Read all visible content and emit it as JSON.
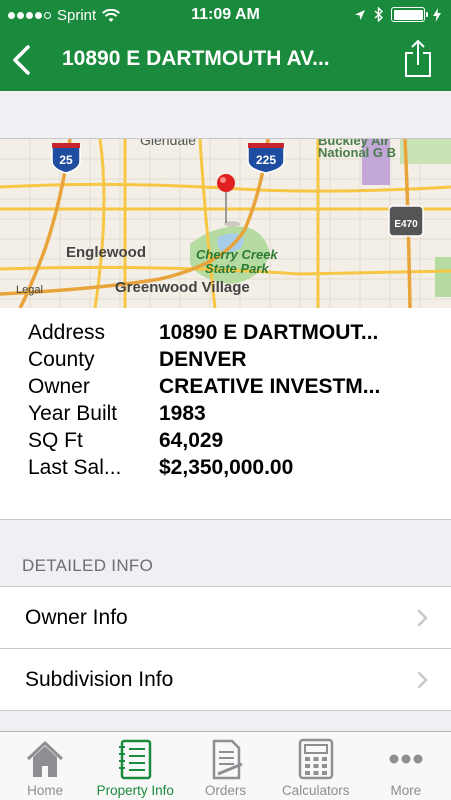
{
  "status_bar": {
    "carrier": "Sprint",
    "time": "11:09 AM",
    "signal_bars": 4,
    "battery_level": 1.0
  },
  "nav": {
    "title": "10890 E DARTMOUTH AV...",
    "back_icon": "chevron-left-icon",
    "share_icon": "share-icon"
  },
  "map": {
    "labels": {
      "glendale": "Glendale",
      "englewood": "Englewood",
      "cherry_creek_1": "Cherry Creek",
      "cherry_creek_2": "State Park",
      "greenwood": "Greenwood Village",
      "national_1": "Buckley Air",
      "national_2": "National G B",
      "legal": "Legal",
      "hwy25": "25",
      "hwy225": "225",
      "e470": "E470"
    },
    "colors": {
      "land": "#f3efe6",
      "road": "#f6c644",
      "park": "#b5dba0",
      "water": "#a6cce8",
      "pin": "#e02020"
    }
  },
  "property": {
    "rows": [
      {
        "label": "Address",
        "value": "10890 E DARTMOUT..."
      },
      {
        "label": "County",
        "value": "DENVER"
      },
      {
        "label": "Owner",
        "value": "CREATIVE INVESTM..."
      },
      {
        "label": "Year Built",
        "value": "1983"
      },
      {
        "label": "SQ Ft",
        "value": "64,029"
      },
      {
        "label": "Last Sal...",
        "value": "$2,350,000.00"
      }
    ]
  },
  "detailed_info": {
    "header": "DETAILED INFO",
    "items": [
      {
        "label": "Owner Info"
      },
      {
        "label": "Subdivision Info"
      }
    ]
  },
  "tabbar": {
    "tabs": [
      {
        "label": "Home",
        "icon": "home-icon",
        "active": false
      },
      {
        "label": "Property Info",
        "icon": "notebook-icon",
        "active": true
      },
      {
        "label": "Orders",
        "icon": "document-icon",
        "active": false
      },
      {
        "label": "Calculators",
        "icon": "calculator-icon",
        "active": false
      },
      {
        "label": "More",
        "icon": "more-dots-icon",
        "active": false
      }
    ]
  },
  "colors": {
    "brand": "#1a8a3c",
    "inactive_tab": "#8e8e93"
  }
}
